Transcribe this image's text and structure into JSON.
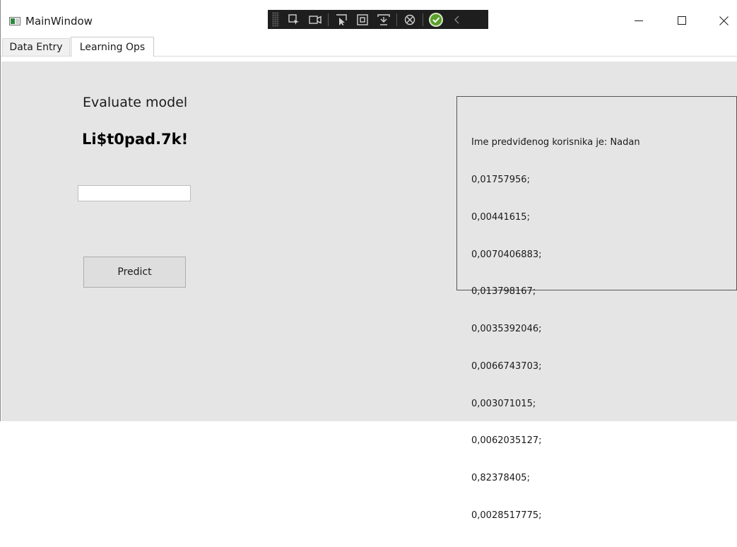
{
  "window": {
    "title": "MainWindow"
  },
  "debug_toolbar": {
    "icons": [
      "select-element-icon",
      "video-camera-icon",
      "pointer-select-icon",
      "display-layout-icon",
      "track-focus-icon",
      "hot-reload-icon",
      "check-circle-icon",
      "collapse-chevron-icon"
    ]
  },
  "caption": {
    "minimize": "—",
    "maximize": "☐",
    "close": "✕"
  },
  "tabs": [
    {
      "label": "Data Entry"
    },
    {
      "label": "Learning Ops"
    }
  ],
  "main": {
    "evaluate_label": "Evaluate model",
    "password_text": "Li$t0pad.7k!",
    "input_value": "",
    "predict_label": "Predict"
  },
  "result": {
    "header": "Ime predviđenog korisnika je: Nadan",
    "values": [
      "0,01757956;",
      "0,00441615;",
      "0,0070406883;",
      "0,013798167;",
      "0,0035392046;",
      "0,0066743703;",
      "0,003071015;",
      "0,0062035127;",
      "0,82378405;",
      "0,0028517775;"
    ]
  },
  "colors": {
    "background": "#e5e5e5",
    "debug_bar": "#1e1e1e",
    "check_green": "#5aa02c"
  }
}
